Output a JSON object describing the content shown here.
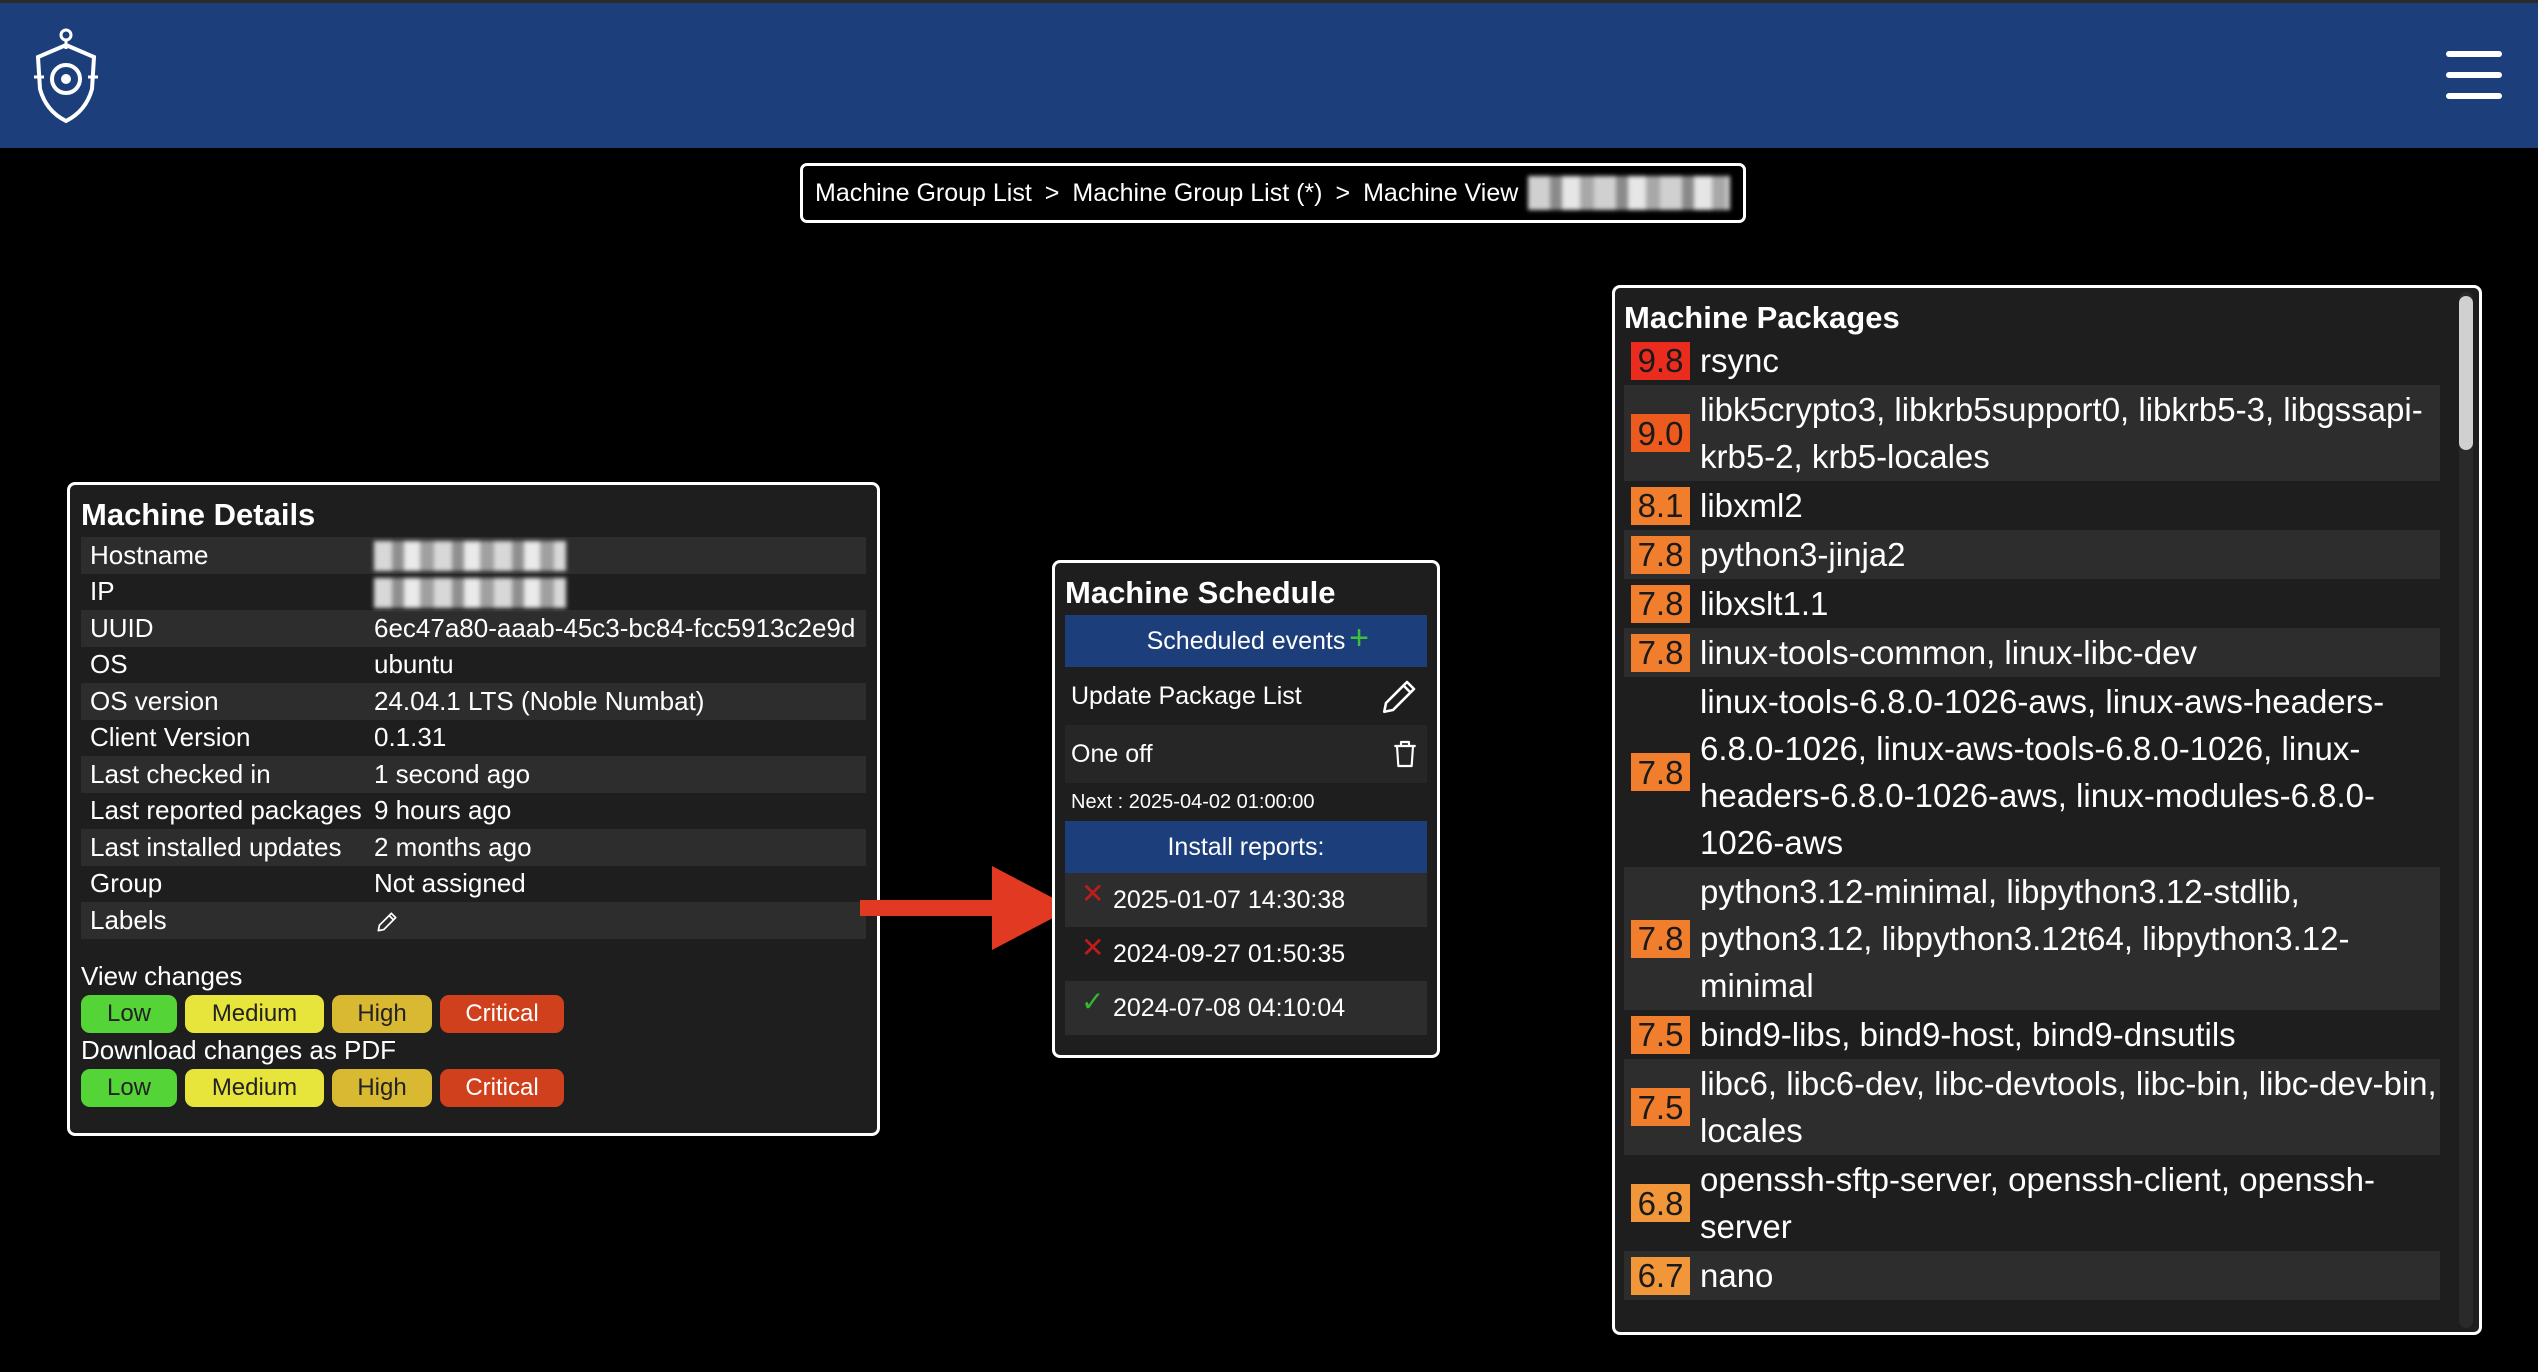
{
  "header": {
    "logo_icon": "shield-gear-logo-icon",
    "menu_icon": "hamburger-menu-icon"
  },
  "breadcrumb": {
    "items": [
      "Machine Group List",
      "Machine Group List (*)",
      "Machine View"
    ],
    "separator": ">"
  },
  "details": {
    "title": "Machine Details",
    "rows": [
      {
        "key": "Hostname",
        "value": ""
      },
      {
        "key": "IP",
        "value": ""
      },
      {
        "key": "UUID",
        "value": "6ec47a80-aaab-45c3-bc84-fcc5913c2e9d"
      },
      {
        "key": "OS",
        "value": "ubuntu"
      },
      {
        "key": "OS version",
        "value": "24.04.1 LTS (Noble Numbat)"
      },
      {
        "key": "Client Version",
        "value": "0.1.31"
      },
      {
        "key": "Last checked in",
        "value": "1 second ago"
      },
      {
        "key": "Last reported packages",
        "value": "9 hours ago"
      },
      {
        "key": "Last installed updates",
        "value": "2 months ago"
      },
      {
        "key": "Group",
        "value": "Not assigned"
      },
      {
        "key": "Labels",
        "value": ""
      }
    ],
    "view_changes_label": "View changes",
    "download_label": "Download changes as PDF",
    "levels": [
      "Low",
      "Medium",
      "High",
      "Critical"
    ]
  },
  "schedule": {
    "title": "Machine Schedule",
    "scheduled_events_label": "Scheduled events",
    "plus": "+",
    "event_name": "Update Package List",
    "event_type": "One off",
    "next": "Next : 2025-04-02 01:00:00",
    "install_reports_label": "Install reports:",
    "reports": [
      {
        "status": "failed",
        "symbol": "✕",
        "time": "2025-01-07 14:30:38"
      },
      {
        "status": "failed",
        "symbol": "✕",
        "time": "2024-09-27 01:50:35"
      },
      {
        "status": "success",
        "symbol": "✓",
        "time": "2024-07-08 04:10:04"
      }
    ]
  },
  "packages": {
    "title": "Machine Packages",
    "items": [
      {
        "score": "9.8",
        "color": "#ea2c1e",
        "names": "rsync"
      },
      {
        "score": "9.0",
        "color": "#ec5a1e",
        "names": "libk5crypto3, libkrb5support0, libkrb5-3, libgssapi-krb5-2, krb5-locales"
      },
      {
        "score": "8.1",
        "color": "#f07e2c",
        "names": "libxml2"
      },
      {
        "score": "7.8",
        "color": "#f07e2c",
        "names": "python3-jinja2"
      },
      {
        "score": "7.8",
        "color": "#f07e2c",
        "names": "libxslt1.1"
      },
      {
        "score": "7.8",
        "color": "#f07e2c",
        "names": "linux-tools-common, linux-libc-dev"
      },
      {
        "score": "7.8",
        "color": "#f07e2c",
        "names": "linux-tools-6.8.0-1026-aws, linux-aws-headers-6.8.0-1026, linux-aws-tools-6.8.0-1026, linux-headers-6.8.0-1026-aws, linux-modules-6.8.0-1026-aws"
      },
      {
        "score": "7.8",
        "color": "#f07e2c",
        "names": "python3.12-minimal, libpython3.12-stdlib, python3.12, libpython3.12t64, libpython3.12-minimal"
      },
      {
        "score": "7.5",
        "color": "#f07e2c",
        "names": "bind9-libs, bind9-host, bind9-dnsutils"
      },
      {
        "score": "7.5",
        "color": "#f07e2c",
        "names": "libc6, libc6-dev, libc-devtools, libc-bin, libc-dev-bin, locales"
      },
      {
        "score": "6.8",
        "color": "#f2963a",
        "names": "openssh-sftp-server, openssh-client, openssh-server"
      },
      {
        "score": "6.7",
        "color": "#f2963a",
        "names": "nano"
      }
    ]
  }
}
